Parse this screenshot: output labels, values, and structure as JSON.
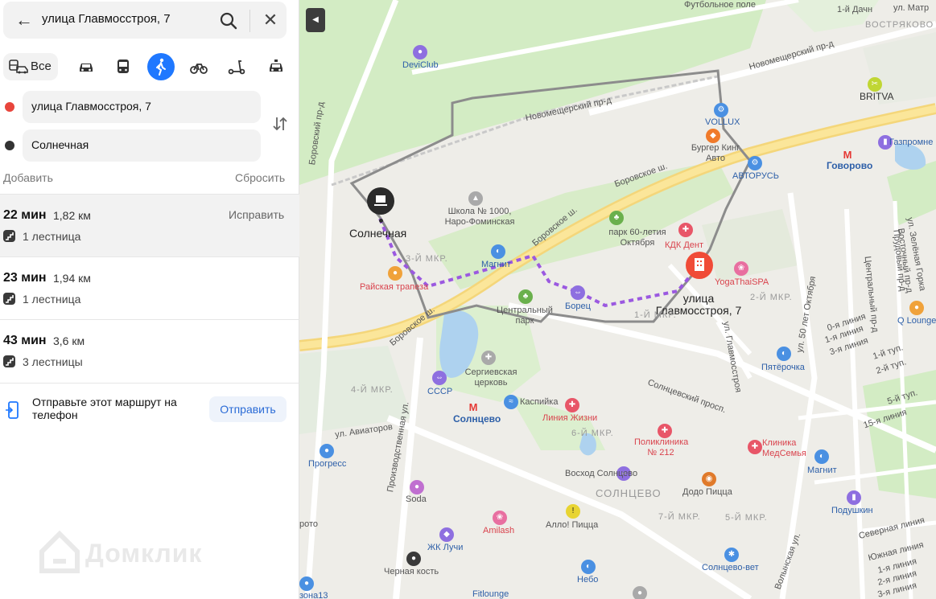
{
  "search": {
    "query": "улица Главмосстроя, 7"
  },
  "modes": {
    "all_label": "Все",
    "items": [
      "car-icon",
      "bus-icon",
      "walk-icon",
      "bike-icon",
      "scooter-icon",
      "taxi-icon"
    ],
    "active": "walk-icon"
  },
  "route_points": {
    "from": "улица Главмосстроя, 7",
    "to": "Солнечная",
    "from_color": "#e8453c",
    "to_color": "#333333"
  },
  "actions": {
    "add": "Добавить",
    "reset": "Сбросить"
  },
  "routes": [
    {
      "time": "22 мин",
      "distance": "1,82 км",
      "stairs": "1 лестница",
      "fix": "Исправить"
    },
    {
      "time": "23 мин",
      "distance": "1,94 км",
      "stairs": "1 лестница"
    },
    {
      "time": "43 мин",
      "distance": "3,6 км",
      "stairs": "3 лестницы"
    }
  ],
  "send": {
    "text": "Отправьте этот маршрут на телефон",
    "button": "Отправить"
  },
  "watermark": "Домклик",
  "map": {
    "accent": "#1f78ff",
    "route_color": "#9b59e0",
    "labels": {
      "football": "Футбольное поле",
      "dacha": "1-й Дачн",
      "vostryakovo": "ВОСТРЯКОВО",
      "matr": "ул. Матр",
      "devi": "DeviClub",
      "novomesh": "Новомещерский пр-д",
      "novomesh2": "Новомещерский пр-д",
      "britva": "BRITVA",
      "volux": "VOLLUX",
      "burger": "Бургер Кинг Авто",
      "govorovo": "Говорово",
      "gazprom": "Газпромне",
      "avtorus": "АВТОРУСЬ",
      "borovskoe1": "Боровское ш.",
      "borovskoe2": "Боровское ш.",
      "borovskoe3": "Боровское ш.",
      "school": "Школа № 1000, Наро-Фоминская",
      "solnechnaya": "Солнечная",
      "park60": "парк 60-летия Октября",
      "kdk": "КДК Дент",
      "yoga": "YogaThaiSPA",
      "mkr3": "3-Й МКР.",
      "magnit1": "Магнит",
      "trapeza": "Райская трапеза",
      "borets": "Борец",
      "dest": "улица Главмосстроя, 7",
      "mkr2": "2-Й МКР.",
      "mkr1": "1-Й МКР.",
      "central_park": "Центральный парк",
      "glavmos": "ул. Главмосстроя",
      "oct50": "ул. 50 лет Октября",
      "pyaterochka": "Пятёрочка",
      "qlounge": "Q Lounge",
      "zelgorka": "ул. Зелёная Горка",
      "vostoch": "Восточный пр-д",
      "prud": "Прудовый пр-д",
      "centr": "Центральный пр-д",
      "line0": "0-я линия",
      "line1": "1-я линия",
      "line3": "3-я линия",
      "tup1": "1-й туп.",
      "tup2": "2-й туп.",
      "tup5": "5-й туп.",
      "line15": "15-я линия",
      "mkr4": "4-Й МКР.",
      "cccp": "СССР",
      "church": "Сергиевская церковь",
      "metro_solntsevo": "Солнцево",
      "kaspiyka": "Каспийка",
      "liniya": "Линия Жизни",
      "solntsevsky": "Солнцевский просп.",
      "aviatorov": "ул. Авиаторов",
      "proizv": "Производственная ул.",
      "progress": "Прогресс",
      "mkr6": "6-Й МКР.",
      "poliklinika": "Поликлиника № 212",
      "klinika": "Клиника МедСемья",
      "magnit2": "Магнит",
      "voshod": "Восход Солнцево",
      "solntsevo_dist": "СОЛНЦЕВО",
      "dodo": "Додо Пицца",
      "soda": "Soda",
      "mkr7": "7-Й МКР.",
      "mkr5": "5-Й МКР.",
      "podushkin": "Подушкин",
      "severnaya": "Северная линия",
      "amilash": "Amilash",
      "allo": "Алло! Пицца",
      "zhk": "ЖК Лучи",
      "yuzhnaya": "Южная линия",
      "line1b": "1-я линия",
      "line2": "2-я линия",
      "line3b": "3-я линия",
      "volynskaya": "Волынская ул.",
      "black": "Черная кость",
      "nebo": "Небо",
      "solntsevo_vet": "Солнцево-вет",
      "fitlounge": "Fitlounge",
      "zona": "зона13",
      "vorsk": "Боровский пр-д",
      "roto": "рото"
    }
  }
}
